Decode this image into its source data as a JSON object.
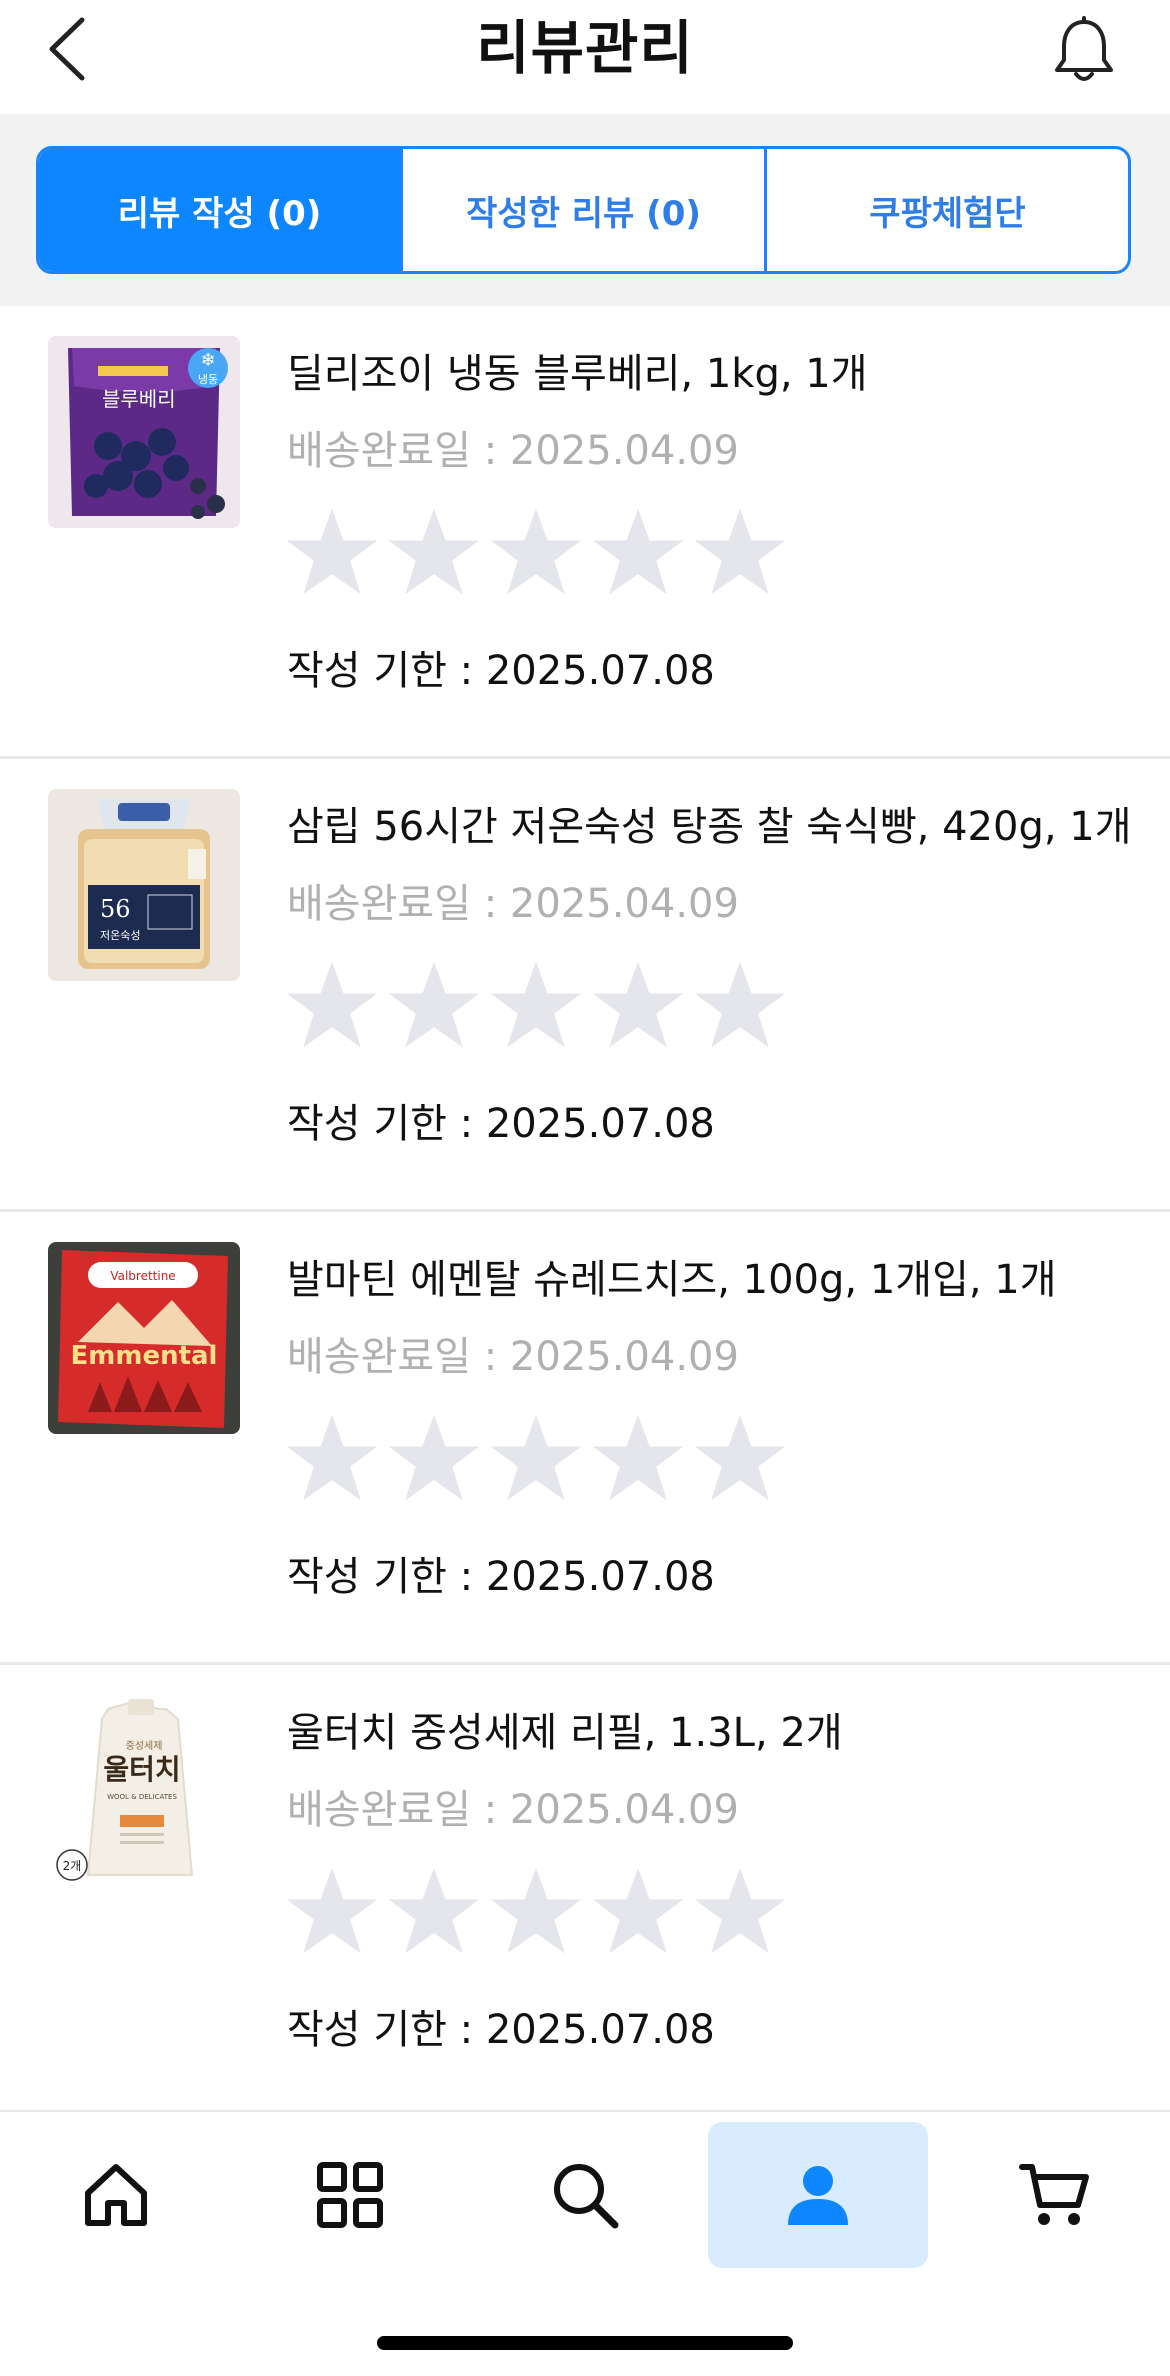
{
  "header": {
    "title": "리뷰관리",
    "back_icon": "chevron-left-icon",
    "bell_icon": "bell-icon"
  },
  "tabs": [
    {
      "label": "리뷰 작성 (0)",
      "active": true
    },
    {
      "label": "작성한 리뷰 (0)",
      "active": false
    },
    {
      "label": "쿠팡체험단",
      "active": false
    }
  ],
  "colors": {
    "accent": "#0d86ff",
    "star_empty": "#e4e6eb",
    "delivered_text": "#b0b0b0"
  },
  "items": [
    {
      "name": "딜리조이 냉동 블루베리, 1kg, 1개",
      "delivered": "배송완료일 : 2025.04.09",
      "deadline": "작성 기한 : 2025.07.08",
      "rating": 0,
      "thumb": {
        "badge": "냉동",
        "brand_label": "블루베리"
      }
    },
    {
      "name": "삼립 56시간 저온숙성 탕종 찰 숙식빵, 420g, 1개",
      "delivered": "배송완료일 : 2025.04.09",
      "deadline": "작성 기한 : 2025.07.08",
      "rating": 0,
      "thumb": {
        "label_number": "56",
        "label_text": "저온숙성"
      }
    },
    {
      "name": "발마틴 에멘탈 슈레드치즈, 100g, 1개입, 1개",
      "delivered": "배송완료일 : 2025.04.09",
      "deadline": "작성 기한 : 2025.07.08",
      "rating": 0,
      "thumb": {
        "brand": "Valbrettine",
        "label_text": "Emmental"
      }
    },
    {
      "name": "울터치 중성세제 리필, 1.3L, 2개",
      "delivered": "배송완료일 : 2025.04.09",
      "deadline": "작성 기한 : 2025.07.08",
      "rating": 0,
      "thumb": {
        "top_text": "중성세제",
        "label_text": "울터치",
        "sub_text": "WOOL & DELICATES",
        "count_badge": "2개"
      }
    }
  ],
  "bottom_nav": [
    {
      "icon": "home-icon",
      "active": false
    },
    {
      "icon": "grid-icon",
      "active": false
    },
    {
      "icon": "search-icon",
      "active": false
    },
    {
      "icon": "person-icon",
      "active": true
    },
    {
      "icon": "cart-icon",
      "active": false
    }
  ]
}
